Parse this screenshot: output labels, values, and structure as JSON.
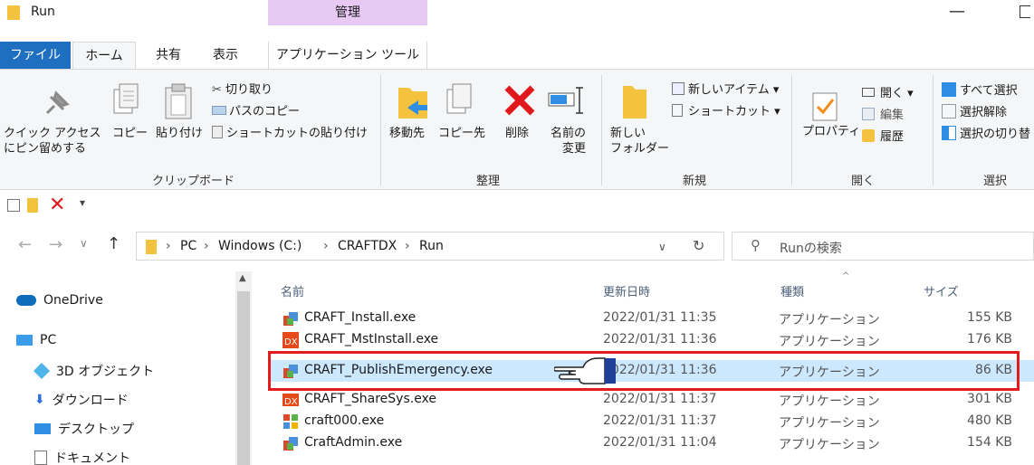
{
  "window": {
    "title": "Run",
    "contextual_tab_group": "管理"
  },
  "ribbon_tabs": [
    "ファイル",
    "ホーム",
    "共有",
    "表示",
    "アプリケーション ツール"
  ],
  "ribbon": {
    "clipboard": {
      "pin_line1": "クイック アクセス",
      "pin_line2": "にピン留めする",
      "copy": "コピー",
      "paste": "貼り付け",
      "cut": "切り取り",
      "copy_path": "パスのコピー",
      "paste_shortcut": "ショートカットの貼り付け",
      "label": "クリップボード"
    },
    "organize": {
      "move_to": "移動先",
      "copy_to": "コピー先",
      "delete": "削除",
      "rename_line1": "名前の",
      "rename_line2": "変更",
      "label": "整理"
    },
    "new": {
      "new_folder_line1": "新しい",
      "new_folder_line2": "フォルダー",
      "new_item": "新しいアイテム ▾",
      "easy_access": "ショートカット ▾",
      "label": "新規"
    },
    "open": {
      "properties": "プロパティ",
      "open": "開く ▾",
      "edit": "編集",
      "history": "履歴",
      "label": "開く"
    },
    "select": {
      "select_all": "すべて選択",
      "select_none": "選択解除",
      "invert": "選択の切り替",
      "label": "選択"
    }
  },
  "address": {
    "crumbs": [
      "PC",
      "Windows (C:)",
      "CRAFTDX",
      "Run"
    ],
    "search_placeholder": "Runの検索"
  },
  "nav_items": [
    "OneDrive",
    "PC",
    "3D オブジェクト",
    "ダウンロード",
    "デスクトップ",
    "ドキュメント"
  ],
  "columns": {
    "name": "名前",
    "date": "更新日時",
    "type": "種類",
    "size": "サイズ"
  },
  "files": [
    {
      "name": "CRAFT_Install.exe",
      "date": "2022/01/31 11:35",
      "type": "アプリケーション",
      "size": "155 KB",
      "icon": "app-icon"
    },
    {
      "name": "CRAFT_MstInstall.exe",
      "date": "2022/01/31 11:36",
      "type": "アプリケーション",
      "size": "176 KB",
      "icon": "craft-dx-icon"
    },
    {
      "name": "CRAFT_PublishEmergency.exe",
      "date": "2022/01/31 11:36",
      "type": "アプリケーション",
      "size": "86 KB",
      "icon": "app-icon"
    },
    {
      "name": "CRAFT_ShareSys.exe",
      "date": "2022/01/31 11:37",
      "type": "アプリケーション",
      "size": "301 KB",
      "icon": "dx-icon"
    },
    {
      "name": "craft000.exe",
      "date": "2022/01/31 11:37",
      "type": "アプリケーション",
      "size": "480 KB",
      "icon": "grid-app-icon"
    },
    {
      "name": "CraftAdmin.exe",
      "date": "2022/01/31 11:04",
      "type": "アプリケーション",
      "size": "154 KB",
      "icon": "app-icon"
    }
  ],
  "colors": {
    "file_tab": "#1e6fbf",
    "manage_tab": "#e7c9f4",
    "selection": "#cce8ff",
    "highlight_border": "#e21c1c"
  }
}
